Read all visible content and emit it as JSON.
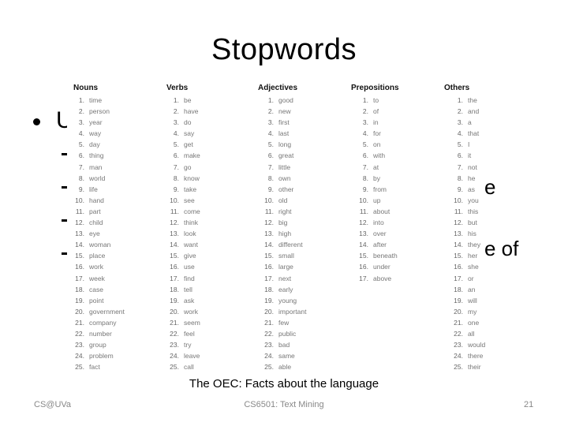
{
  "slide": {
    "title": "Stopwords",
    "bullet_visible": "U",
    "fragment_line2": "e",
    "fragment_line4": "e of",
    "caption": "The OEC: Facts about the language",
    "footer_left": "CS@UVa",
    "footer_center": "CS6501: Text Mining",
    "page_number": "21"
  },
  "table": {
    "columns": [
      {
        "header": "Nouns",
        "words": [
          "time",
          "person",
          "year",
          "way",
          "day",
          "thing",
          "man",
          "world",
          "life",
          "hand",
          "part",
          "child",
          "eye",
          "woman",
          "place",
          "work",
          "week",
          "case",
          "point",
          "government",
          "company",
          "number",
          "group",
          "problem",
          "fact"
        ]
      },
      {
        "header": "Verbs",
        "words": [
          "be",
          "have",
          "do",
          "say",
          "get",
          "make",
          "go",
          "know",
          "take",
          "see",
          "come",
          "think",
          "look",
          "want",
          "give",
          "use",
          "find",
          "tell",
          "ask",
          "work",
          "seem",
          "feel",
          "try",
          "leave",
          "call"
        ]
      },
      {
        "header": "Adjectives",
        "words": [
          "good",
          "new",
          "first",
          "last",
          "long",
          "great",
          "little",
          "own",
          "other",
          "old",
          "right",
          "big",
          "high",
          "different",
          "small",
          "large",
          "next",
          "early",
          "young",
          "important",
          "few",
          "public",
          "bad",
          "same",
          "able"
        ]
      },
      {
        "header": "Prepositions",
        "words": [
          "to",
          "of",
          "in",
          "for",
          "on",
          "with",
          "at",
          "by",
          "from",
          "up",
          "about",
          "into",
          "over",
          "after",
          "beneath",
          "under",
          "above"
        ]
      },
      {
        "header": "Others",
        "words": [
          "the",
          "and",
          "a",
          "that",
          "I",
          "it",
          "not",
          "he",
          "as",
          "you",
          "this",
          "but",
          "his",
          "they",
          "her",
          "she",
          "or",
          "an",
          "will",
          "my",
          "one",
          "all",
          "would",
          "there",
          "their"
        ]
      }
    ]
  }
}
